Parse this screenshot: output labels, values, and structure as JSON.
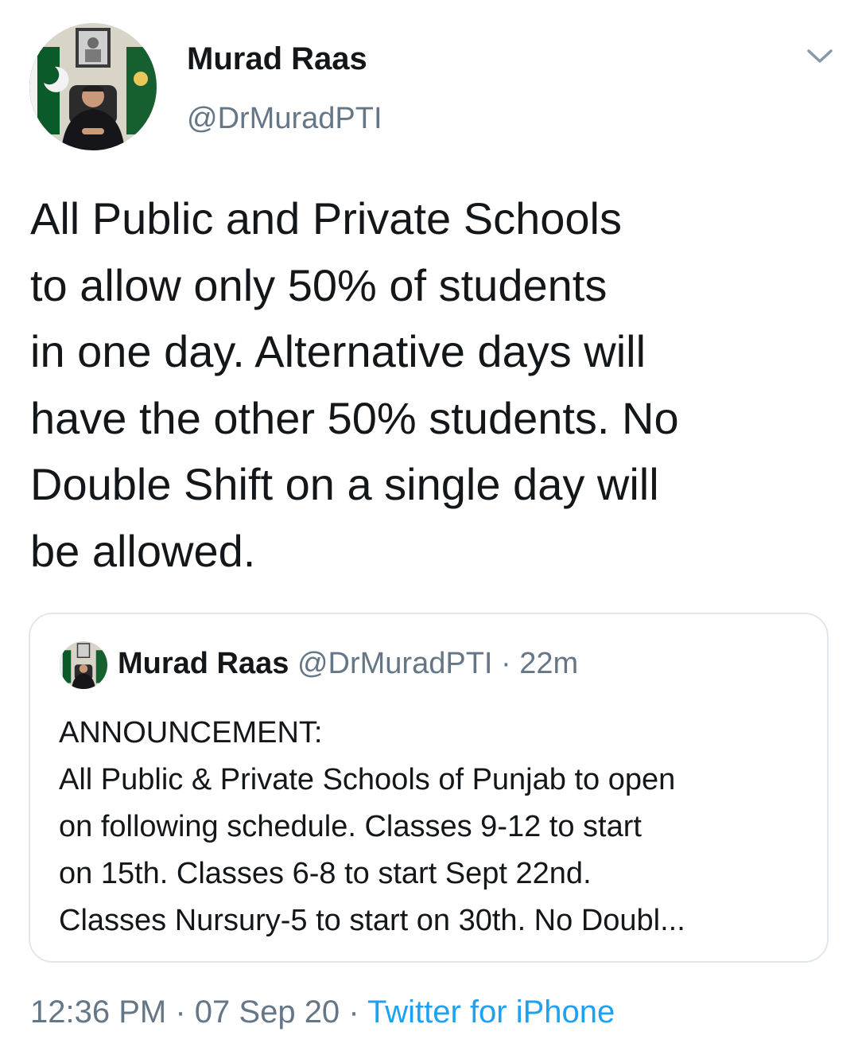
{
  "tweet": {
    "author": {
      "name": "Murad Raas",
      "handle": "@DrMuradPTI",
      "avatar_icon": "profile-photo-icon"
    },
    "menu_icon": "chevron-down-icon",
    "text_lines": [
      "All Public and Private Schools",
      "to allow only 50% of students",
      "in one day. Alternative days will",
      "have the other 50% students. No",
      "Double Shift on a single day will",
      "be allowed."
    ],
    "quoted": {
      "name": "Murad Raas",
      "handle": "@DrMuradPTI",
      "separator": "·",
      "time": "22m",
      "text_lines": [
        "ANNOUNCEMENT:",
        "All Public & Private Schools of Punjab to open",
        "on following schedule. Classes 9-12 to start",
        "on 15th. Classes 6-8 to start Sept 22nd.",
        "Classes Nursury-5 to start on 30th. No Doubl..."
      ]
    },
    "meta": {
      "time": "12:36 PM",
      "sep1": "·",
      "date": "07 Sep 20",
      "sep2": "·",
      "source": "Twitter for iPhone"
    }
  },
  "colors": {
    "text": "#14171a",
    "secondary": "#657786",
    "link": "#1da1f2",
    "border": "#e1e8ed"
  }
}
